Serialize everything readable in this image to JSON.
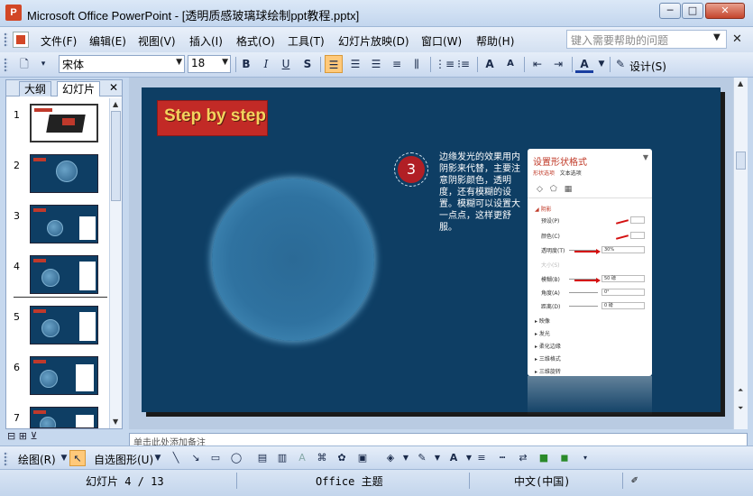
{
  "window": {
    "app_icon": "P",
    "title": "Microsoft Office PowerPoint - [透明质感玻璃球绘制ppt教程.pptx]",
    "minimize": "─",
    "maximize": "□",
    "close": "✕"
  },
  "menu": {
    "items": [
      "文件(F)",
      "编辑(E)",
      "视图(V)",
      "插入(I)",
      "格式(O)",
      "工具(T)",
      "幻灯片放映(D)",
      "窗口(W)",
      "帮助(H)"
    ],
    "help_placeholder": "键入需要帮助的问题",
    "close_glyph": "✕"
  },
  "toolbar": {
    "font_name": "宋体",
    "font_size": "18",
    "bold": "B",
    "italic": "I",
    "underline": "U",
    "shadow": "S",
    "design": "设计(S)"
  },
  "left_panel": {
    "tabs": [
      "大纲",
      "幻灯片"
    ],
    "close_glyph": "✕",
    "slide_numbers": [
      "1",
      "2",
      "3",
      "4",
      "5",
      "6",
      "7"
    ]
  },
  "slide": {
    "badge_text": "Step by step",
    "step_number": "3",
    "description": "边缘发光的效果用内阴影来代替，主要注意阴影颜色，透明度，还有模糊的设置。模糊可以设置大一点点，这样更舒服。",
    "pane": {
      "title": "设置形状格式",
      "tabs": [
        "形状选项",
        "文本选项"
      ],
      "section": "阴影",
      "rows": [
        {
          "label": "预设(P)",
          "value": ""
        },
        {
          "label": "颜色(C)",
          "value": ""
        },
        {
          "label": "透明度(T)",
          "value": "30%"
        },
        {
          "label": "大小(S)",
          "value": ""
        },
        {
          "label": "模糊(B)",
          "value": "50 磅"
        },
        {
          "label": "角度(A)",
          "value": "0°"
        },
        {
          "label": "距离(D)",
          "value": "0 磅"
        }
      ],
      "items": [
        "映像",
        "发光",
        "柔化边缘",
        "三维格式",
        "三维旋转"
      ]
    }
  },
  "notes": {
    "placeholder": "单击此处添加备注"
  },
  "drawbar": {
    "draw": "绘图(R)",
    "autoshapes": "自选图形(U)"
  },
  "status": {
    "slide_pos": "幻灯片 4 / 13",
    "theme": "Office 主题",
    "language": "中文(中国)"
  },
  "colors": {
    "slide_bg": "#0e3e64",
    "accent_red": "#c22a26",
    "badge_text": "#f4d35e"
  }
}
